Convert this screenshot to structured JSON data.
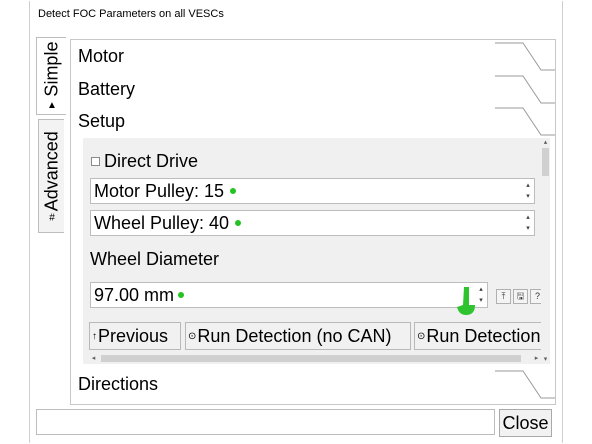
{
  "window": {
    "title": "Detect FOC Parameters on all VESCs"
  },
  "tabs": [
    {
      "label": "Simple",
      "icon": "simple-icon",
      "active": true
    },
    {
      "label": "Advanced",
      "icon": "advanced-icon",
      "active": false
    }
  ],
  "sections": {
    "motor": "Motor",
    "battery": "Battery",
    "setup": "Setup",
    "directions": "Directions"
  },
  "setup": {
    "direct_drive_label": "Direct Drive",
    "direct_drive_checked": false,
    "motor_pulley": "Motor Pulley: 15",
    "wheel_pulley": "Wheel Pulley: 40",
    "wheel_diameter_label": "Wheel Diameter",
    "wheel_diameter_value": "97.00 mm",
    "buttons": {
      "previous": "Previous",
      "run_no_can": "Run Detection (no CAN)",
      "run_detection": "Run Detection"
    }
  },
  "icons": {
    "spin_up": "▴",
    "spin_down": "▾",
    "previous_glyph": "↑",
    "run_glyph": "⊙",
    "upload": "⤒",
    "save": "🖫",
    "help": "?"
  },
  "colors": {
    "status_dot": "#22c322",
    "pointer": "#2fc42f"
  },
  "footer": {
    "close_label": "Close",
    "status_value": ""
  }
}
